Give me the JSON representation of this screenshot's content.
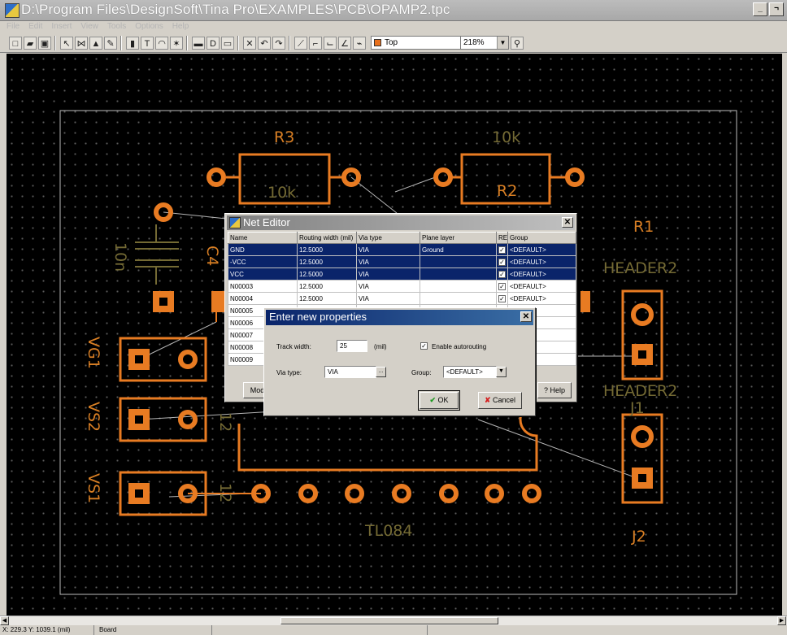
{
  "window": {
    "title": "D:\\Program Files\\DesignSoft\\Tina Pro\\EXAMPLES\\PCB\\OPAMP2.tpc",
    "minimize": "_",
    "restore": "¬"
  },
  "menu": [
    "File",
    "Edit",
    "Insert",
    "View",
    "Tools",
    "Options",
    "Help"
  ],
  "toolbar": {
    "layer_value": "Top",
    "zoom_value": "218%"
  },
  "board": {
    "labels": {
      "r3": "R3",
      "r3_value": "10k",
      "r2_value": "10k",
      "r2": "R2",
      "r1": "R1",
      "header2_top": "HEADER2",
      "header2_bottom": "HEADER2",
      "j1": "J1",
      "j2": "J2",
      "c_value": "10n",
      "c4": "C4",
      "vg1": "VG1",
      "vs2": "VS2",
      "vs1": "VS1",
      "tl084": "TL084",
      "pin12a": "12",
      "pin12b": "12"
    },
    "colors": {
      "copper": "#e87b22",
      "silk_dim": "#746a34",
      "background": "#000000"
    }
  },
  "status": {
    "coords": "X: 229.3  Y: 1039.1  (mil)",
    "mode": "Board"
  },
  "net_editor": {
    "title": "Net Editor",
    "columns": [
      "Name",
      "Routing width (mil)",
      "Via type",
      "Plane layer",
      "RE",
      "Group"
    ],
    "rows": [
      {
        "name": "GND",
        "width": "12.5000",
        "via": "VIA",
        "plane": "Ground",
        "re": true,
        "group": "<DEFAULT>",
        "selected": true
      },
      {
        "name": "-VCC",
        "width": "12.5000",
        "via": "VIA",
        "plane": "",
        "re": true,
        "group": "<DEFAULT>",
        "selected": true
      },
      {
        "name": "VCC",
        "width": "12.5000",
        "via": "VIA",
        "plane": "",
        "re": true,
        "group": "<DEFAULT>",
        "selected": true
      },
      {
        "name": "N00003",
        "width": "12.5000",
        "via": "VIA",
        "plane": "",
        "re": true,
        "group": "<DEFAULT>",
        "selected": false
      },
      {
        "name": "N00004",
        "width": "12.5000",
        "via": "VIA",
        "plane": "",
        "re": true,
        "group": "<DEFAULT>",
        "selected": false
      },
      {
        "name": "N00005",
        "width": "",
        "via": "",
        "plane": "",
        "re": null,
        "group": "ULT>",
        "selected": false
      },
      {
        "name": "N00006",
        "width": "",
        "via": "",
        "plane": "",
        "re": null,
        "group": "ULT>",
        "selected": false
      },
      {
        "name": "N00007",
        "width": "",
        "via": "",
        "plane": "",
        "re": null,
        "group": "ULT>",
        "selected": false
      },
      {
        "name": "N00008",
        "width": "",
        "via": "",
        "plane": "",
        "re": null,
        "group": "ULT>",
        "selected": false
      },
      {
        "name": "N00009",
        "width": "",
        "via": "",
        "plane": "",
        "re": null,
        "group": "ULT>",
        "selected": false
      }
    ],
    "modify_label": "Modify",
    "help_label": "Help"
  },
  "props_dialog": {
    "title": "Enter new properties",
    "track_width_label": "Track width:",
    "track_width_value": "25",
    "track_width_unit": "(mil)",
    "autorouting_label": "Enable autorouting",
    "autorouting_checked": true,
    "via_type_label": "Via type:",
    "via_type_value": "VIA",
    "browse_label": "...",
    "group_label": "Group:",
    "group_value": "<DEFAULT>",
    "ok_label": "OK",
    "cancel_label": "Cancel"
  }
}
